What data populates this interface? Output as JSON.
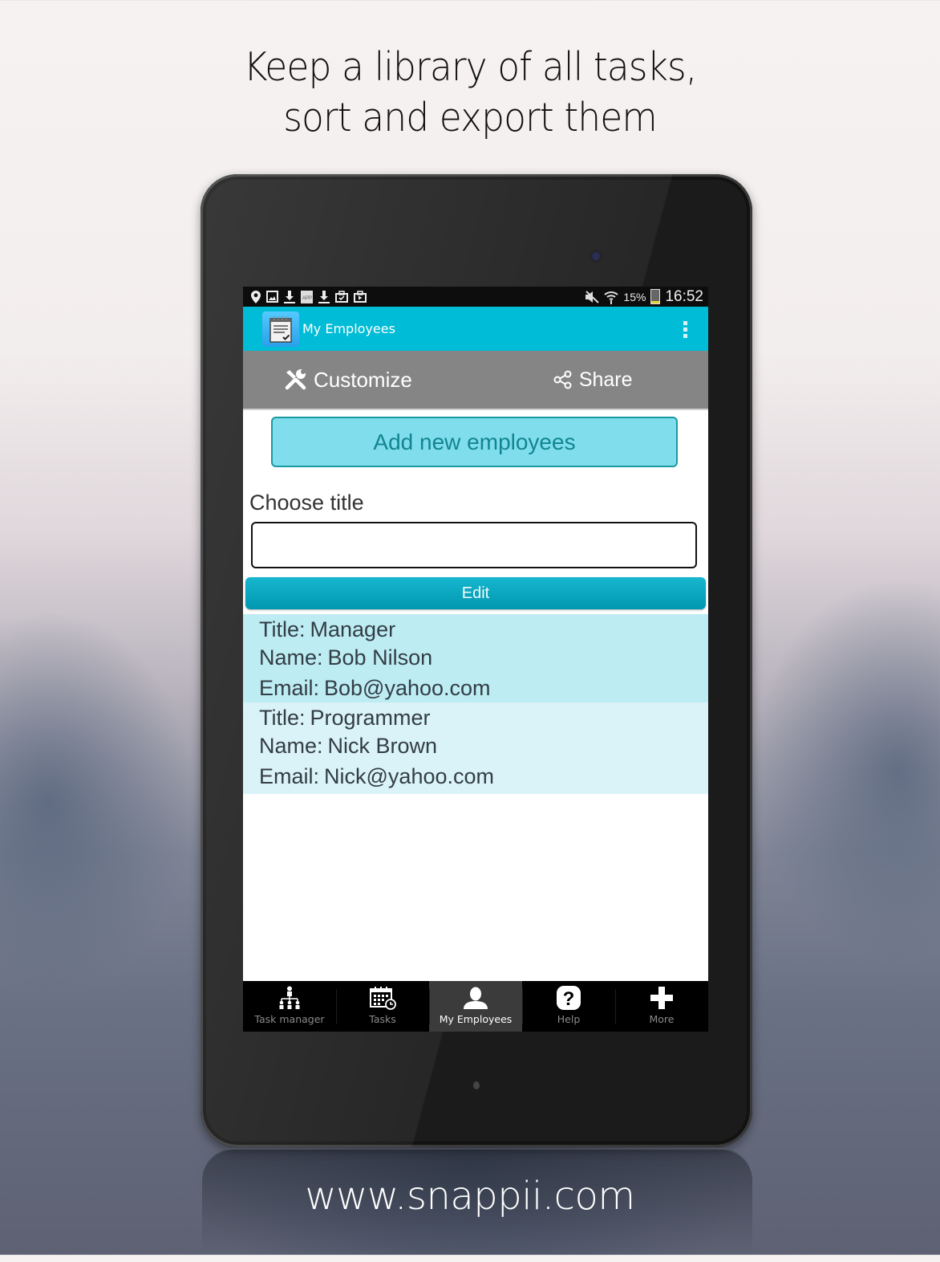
{
  "promo": {
    "headline_line1": "Keep a library of all tasks,",
    "headline_line2": "sort and export them",
    "footer_url": "www.snappii.com"
  },
  "status_bar": {
    "left_icons": [
      "location-icon",
      "image-icon",
      "download-icon",
      "app-icon",
      "download-icon",
      "briefcase-check-icon",
      "briefcase-play-icon"
    ],
    "right_icons": [
      "mute-icon",
      "wifi-icon"
    ],
    "battery_percent": "15%",
    "battery_level": 0.15,
    "time": "16:52"
  },
  "action_bar": {
    "title": "My Employees",
    "menu_icon": "overflow-menu-icon"
  },
  "toolbar": {
    "customize_label": "Customize",
    "share_label": "Share"
  },
  "content": {
    "add_button_label": "Add new employees",
    "choose_title_label": "Choose title",
    "title_input_value": "",
    "title_input_placeholder": "",
    "edit_button_label": "Edit"
  },
  "labels": {
    "title": "Title:",
    "name": "Name:",
    "email": "Email:"
  },
  "employees": [
    {
      "title": "Manager",
      "name": "Bob Nilson",
      "email": "Bob@yahoo.com"
    },
    {
      "title": "Programmer",
      "name": "Nick Brown",
      "email": "Nick@yahoo.com"
    }
  ],
  "bottom_nav": {
    "items": [
      {
        "label": "Task manager",
        "icon": "org-chart-icon",
        "active": false
      },
      {
        "label": "Tasks",
        "icon": "calendar-clock-icon",
        "active": false
      },
      {
        "label": "My Employees",
        "icon": "person-icon",
        "active": true
      },
      {
        "label": "Help",
        "icon": "help-icon",
        "active": false
      },
      {
        "label": "More",
        "icon": "plus-icon",
        "active": false
      }
    ]
  },
  "colors": {
    "action_bar": "#00bcd6",
    "toolbar": "#858585",
    "add_button_bg": "#80deec",
    "edit_button": "#0097b0",
    "row_1_bg": "#bdecf3",
    "row_2_bg": "#daf3f8"
  }
}
